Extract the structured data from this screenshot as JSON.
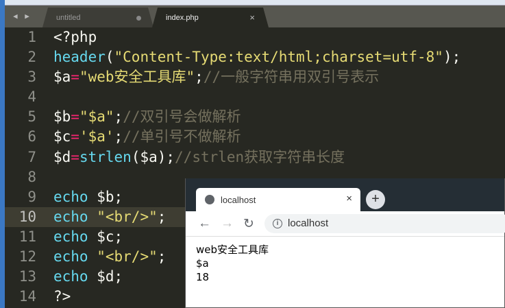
{
  "editor": {
    "nav_arrows": "◀ ▶",
    "tabs": [
      {
        "label": "untitled",
        "modified": true
      },
      {
        "label": "index.php",
        "close": "×"
      }
    ],
    "highlighted_line": 10,
    "lines": [
      {
        "n": "1",
        "tokens": [
          {
            "c": "tx",
            "t": "<?php"
          }
        ]
      },
      {
        "n": "2",
        "tokens": [
          {
            "c": "kw",
            "t": "header"
          },
          {
            "c": "tx",
            "t": "("
          },
          {
            "c": "str",
            "t": "\"Content-Type:text/html;charset=utf-8\""
          },
          {
            "c": "tx",
            "t": ");"
          }
        ]
      },
      {
        "n": "3",
        "tokens": [
          {
            "c": "tx",
            "t": "$a"
          },
          {
            "c": "op",
            "t": "="
          },
          {
            "c": "str",
            "t": "\"web安全工具库\""
          },
          {
            "c": "tx",
            "t": ";"
          },
          {
            "c": "cm",
            "t": "//一般字符串用双引号表示"
          }
        ]
      },
      {
        "n": "4",
        "tokens": []
      },
      {
        "n": "5",
        "tokens": [
          {
            "c": "tx",
            "t": "$b"
          },
          {
            "c": "op",
            "t": "="
          },
          {
            "c": "str",
            "t": "\"$a\""
          },
          {
            "c": "tx",
            "t": ";"
          },
          {
            "c": "cm",
            "t": "//双引号会做解析"
          }
        ]
      },
      {
        "n": "6",
        "tokens": [
          {
            "c": "tx",
            "t": "$c"
          },
          {
            "c": "op",
            "t": "="
          },
          {
            "c": "str",
            "t": "'$a'"
          },
          {
            "c": "tx",
            "t": ";"
          },
          {
            "c": "cm",
            "t": "//单引号不做解析"
          }
        ]
      },
      {
        "n": "7",
        "tokens": [
          {
            "c": "tx",
            "t": "$d"
          },
          {
            "c": "op",
            "t": "="
          },
          {
            "c": "kw",
            "t": "strlen"
          },
          {
            "c": "tx",
            "t": "($a);"
          },
          {
            "c": "cm",
            "t": "//strlen获取字符串长度"
          }
        ]
      },
      {
        "n": "8",
        "tokens": []
      },
      {
        "n": "9",
        "tokens": [
          {
            "c": "kw",
            "t": "echo"
          },
          {
            "c": "tx",
            "t": " $b;"
          }
        ]
      },
      {
        "n": "10",
        "tokens": [
          {
            "c": "kw",
            "t": "echo"
          },
          {
            "c": "tx",
            "t": " "
          },
          {
            "c": "str",
            "t": "\"<br/>\""
          },
          {
            "c": "tx",
            "t": ";"
          }
        ]
      },
      {
        "n": "11",
        "tokens": [
          {
            "c": "kw",
            "t": "echo"
          },
          {
            "c": "tx",
            "t": " $c;"
          }
        ]
      },
      {
        "n": "12",
        "tokens": [
          {
            "c": "kw",
            "t": "echo"
          },
          {
            "c": "tx",
            "t": " "
          },
          {
            "c": "str",
            "t": "\"<br/>\""
          },
          {
            "c": "tx",
            "t": ";"
          }
        ]
      },
      {
        "n": "13",
        "tokens": [
          {
            "c": "kw",
            "t": "echo"
          },
          {
            "c": "tx",
            "t": " $d;"
          }
        ]
      },
      {
        "n": "14",
        "tokens": [
          {
            "c": "tx",
            "t": "?>"
          }
        ]
      }
    ]
  },
  "browser": {
    "tab_title": "localhost",
    "tab_close": "×",
    "new_tab": "+",
    "back": "←",
    "forward": "→",
    "reload": "↻",
    "info": "i",
    "url": "localhost",
    "output": [
      "web安全工具库",
      "$a",
      "18"
    ]
  }
}
